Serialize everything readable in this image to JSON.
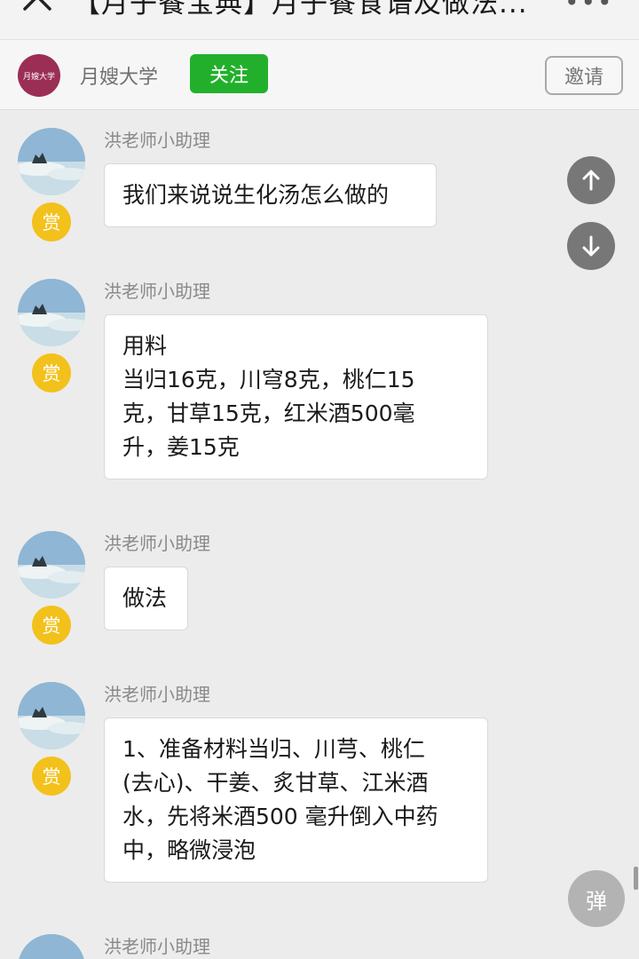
{
  "header": {
    "title": "【月子餐宝典】月子餐食谱及做法...",
    "close_icon": "close-icon",
    "more_icon": "more-icon"
  },
  "channel": {
    "logo_text": "月嫂大学",
    "name": "月嫂大学",
    "follow_label": "关注",
    "invite_label": "邀请",
    "follow_color": "#22b02c"
  },
  "messages": [
    {
      "sender": "洪老师小助理",
      "tip_label": "赏",
      "lines": [
        "我们来说说生化汤怎么做的"
      ]
    },
    {
      "sender": "洪老师小助理",
      "tip_label": "赏",
      "lines": [
        "用料",
        "当归16克，川穹8克，桃仁15",
        "克，甘草15克，红米酒500毫",
        "升，姜15克"
      ]
    },
    {
      "sender": "洪老师小助理",
      "tip_label": "赏",
      "lines": [
        "做法"
      ]
    },
    {
      "sender": "洪老师小助理",
      "tip_label": "赏",
      "lines": [
        "1、准备材料当归、川芎、桃仁",
        "(去心)、干姜、炙甘草、江米酒",
        "水，先将米酒500 毫升倒入中药",
        "中，略微浸泡"
      ]
    },
    {
      "sender": "洪老师小助理"
    }
  ],
  "controls": {
    "scroll_up_icon": "arrow-up-icon",
    "scroll_down_icon": "arrow-down-icon",
    "danmu_label": "弹",
    "tip_color": "#f3c11b"
  }
}
